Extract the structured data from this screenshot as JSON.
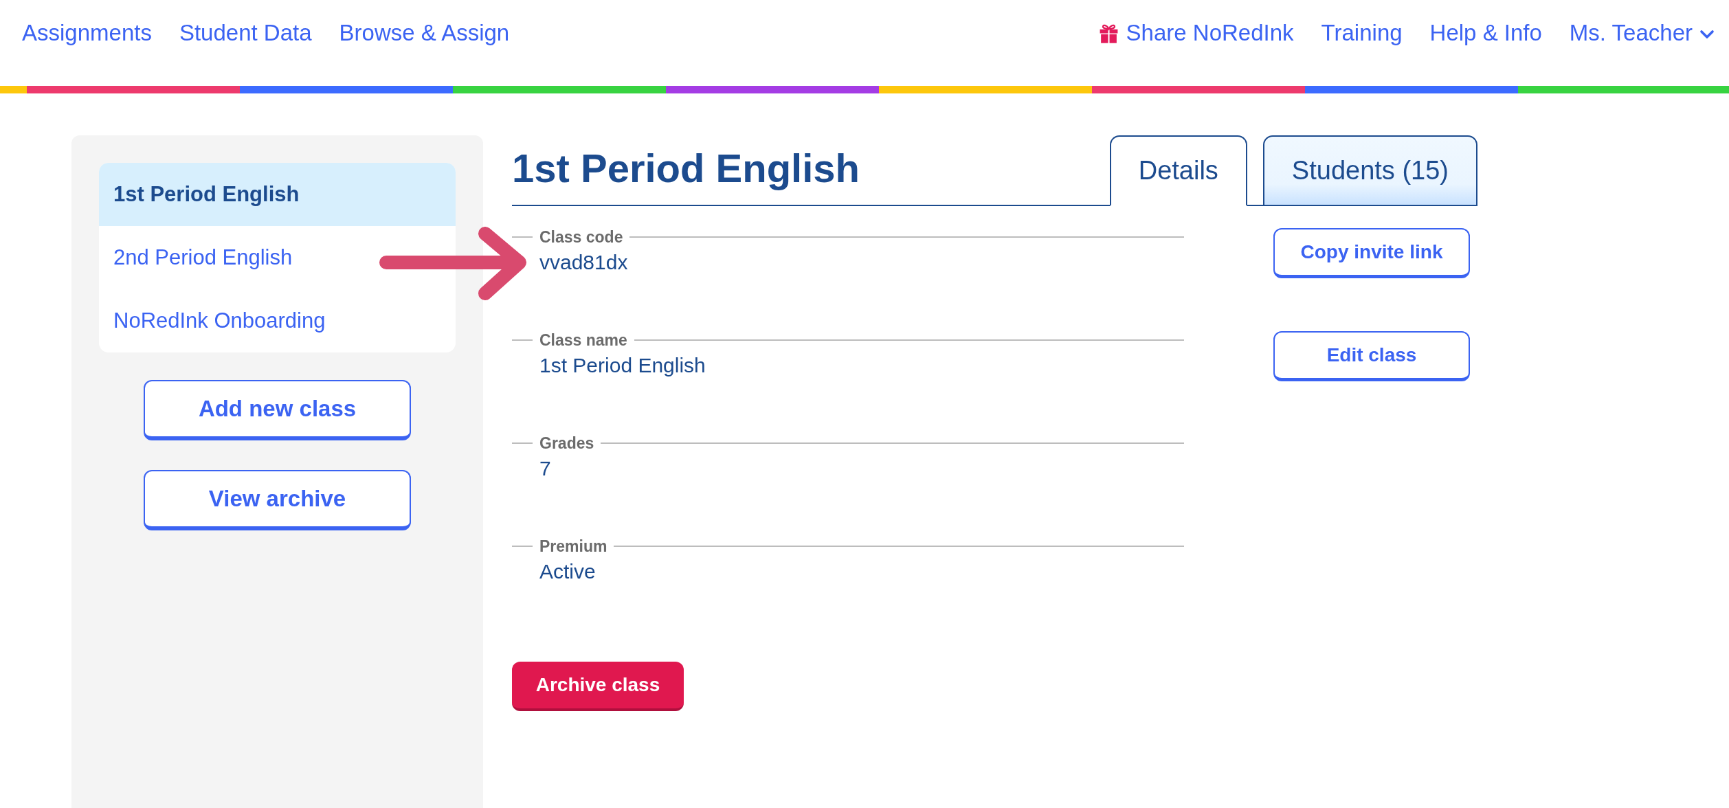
{
  "nav": {
    "left": [
      {
        "label": "Assignments"
      },
      {
        "label": "Student Data"
      },
      {
        "label": "Browse & Assign"
      }
    ],
    "right": [
      {
        "label": "Share NoRedInk",
        "kind": "share"
      },
      {
        "label": "Training",
        "kind": "link"
      },
      {
        "label": "Help & Info",
        "kind": "link"
      },
      {
        "label": "Ms. Teacher",
        "kind": "menu"
      }
    ]
  },
  "sidebar": {
    "classes": [
      {
        "label": "1st Period English",
        "selected": true
      },
      {
        "label": "2nd Period English",
        "selected": false
      },
      {
        "label": "NoRedInk Onboarding",
        "selected": false
      }
    ],
    "buttons": [
      "Add new class",
      "View archive"
    ]
  },
  "main": {
    "title": "1st Period English",
    "tabs": [
      {
        "label": "Details",
        "selected": true
      },
      {
        "label": "Students (15)",
        "selected": false
      }
    ],
    "fields": [
      {
        "label": "Class code",
        "value": "vvad81dx",
        "action": "Copy invite link"
      },
      {
        "label": "Class name",
        "value": "1st Period English",
        "action": "Edit class"
      },
      {
        "label": "Grades",
        "value": "7"
      },
      {
        "label": "Premium",
        "value": "Active"
      }
    ],
    "archive_button": "Archive class"
  }
}
